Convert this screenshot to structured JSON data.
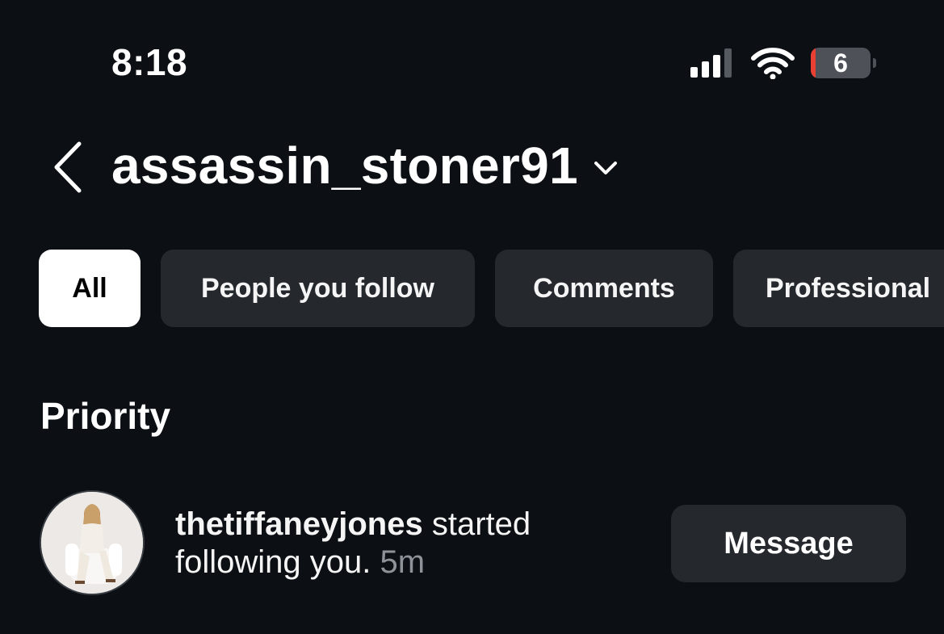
{
  "status_bar": {
    "time": "8:18",
    "signal_bars": 3,
    "signal_bars_total": 4,
    "wifi_icon": "wifi-icon",
    "battery_percent": "6",
    "battery_low_color": "#ea4034"
  },
  "header": {
    "back_icon": "chevron-left-icon",
    "username": "assassin_stoner91",
    "dropdown_icon": "chevron-down-icon"
  },
  "filters": [
    {
      "label": "All",
      "active": true
    },
    {
      "label": "People you follow",
      "active": false
    },
    {
      "label": "Comments",
      "active": false
    },
    {
      "label": "Professional",
      "active": false
    }
  ],
  "section": {
    "title": "Priority"
  },
  "notification": {
    "username": "thetiffaneyjones",
    "action": " started following you.",
    "time": "5m",
    "button_label": "Message"
  },
  "colors": {
    "background": "#0c1014",
    "chip_bg": "#25292e",
    "active_chip_bg": "#ffffff",
    "muted_text": "#8e9399"
  }
}
